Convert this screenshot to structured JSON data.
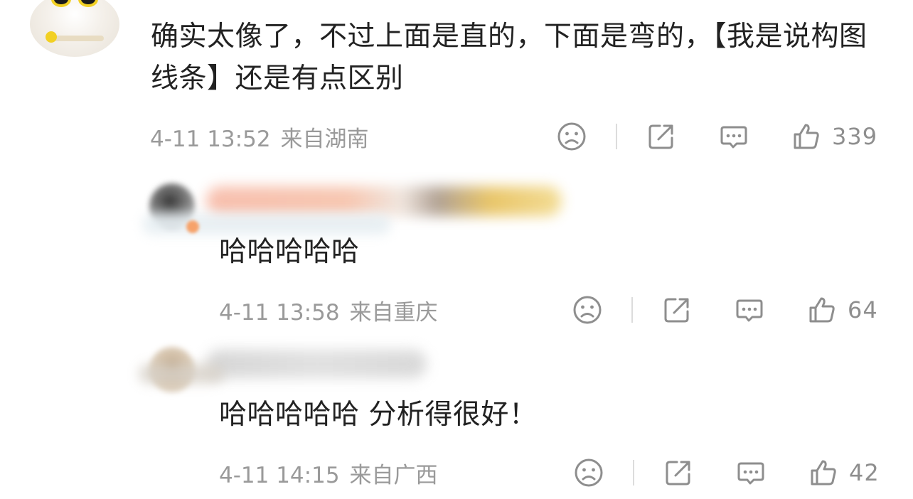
{
  "comments": [
    {
      "text": "确实太像了，不过上面是直的，下面是弯的，【我是说构图线条】还是有点区别",
      "time": "4-11 13:52",
      "location": "来自湖南",
      "likes": "339"
    },
    {
      "text": "哈哈哈哈哈",
      "time": "4-11 13:58",
      "location": "来自重庆",
      "likes": "64"
    },
    {
      "text": "哈哈哈哈哈 分析得很好！",
      "time": "4-11 14:15",
      "location": "来自广西",
      "likes": "42"
    }
  ],
  "icons": {
    "sad": "sad-face-icon",
    "share": "share-icon",
    "comment": "comment-icon",
    "like": "thumbs-up-icon"
  },
  "colors": {
    "text": "#222222",
    "meta": "#9a9a9a",
    "icon": "#8e8e8e"
  }
}
